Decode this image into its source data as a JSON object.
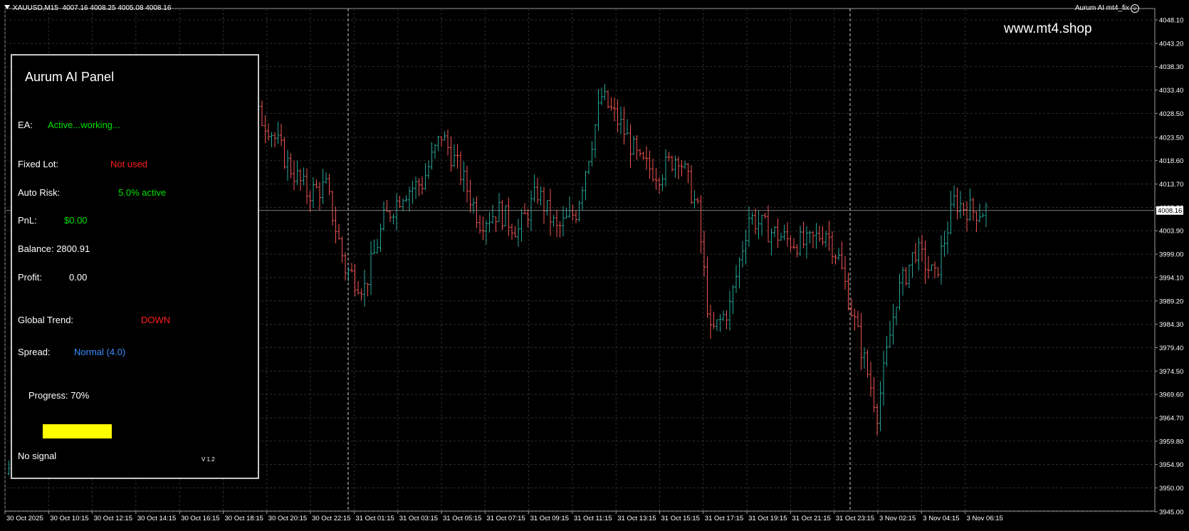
{
  "header": {
    "symbol": "XAUUSD,M15",
    "ohlc": "4007.16 4008.25 4005.08 4008.16",
    "ea_name": "Aurum AI mt4_fix"
  },
  "watermark": "www.mt4.shop",
  "panel": {
    "title": "Aurum AI Panel",
    "ea_label": "EA:",
    "ea_value": "Active...working...",
    "fixed_lot_label": "Fixed Lot:",
    "fixed_lot_value": "Not used",
    "auto_risk_label": "Auto Risk:",
    "auto_risk_value": "5.0% active",
    "pnl_label": "PnL:",
    "pnl_value": "$0.00",
    "balance_text": "Balance: 2800.91",
    "profit_label": "Profit:",
    "profit_value": "0.00",
    "global_trend_label": "Global Trend:",
    "global_trend_value": "DOWN",
    "spread_label": "Spread:",
    "spread_value": "Normal (4.0)",
    "progress_text": "Progress: 70%",
    "progress": 0.7,
    "signal_text": "No signal",
    "version": "V 1.2"
  },
  "colors": {
    "background": "#000000",
    "grid": "#2e2e2e",
    "bull": "#26a69a",
    "bear": "#ef5350",
    "green_text": "#00e000",
    "red_text": "#ff2020",
    "blue_text": "#3a8eff",
    "progress": "#ffff00",
    "panel_border": "#c8c8c8"
  },
  "chart_data": {
    "type": "candlestick",
    "symbol": "XAUUSD",
    "timeframe": "M15",
    "y_ticks": [
      "4048.10",
      "4043.20",
      "4038.30",
      "4033.40",
      "4028.50",
      "4023.50",
      "4018.60",
      "4013.70",
      "4008.80",
      "4003.90",
      "3999.00",
      "3994.10",
      "3989.20",
      "3984.30",
      "3979.40",
      "3974.50",
      "3969.60",
      "3964.70",
      "3959.80",
      "3954.90",
      "3950.00",
      "3945.00"
    ],
    "ylim": [
      3945.0,
      4048.1
    ],
    "x_ticks": [
      "30 Oct 2025",
      "30 Oct 10:15",
      "30 Oct 12:15",
      "30 Oct 14:15",
      "30 Oct 16:15",
      "30 Oct 18:15",
      "30 Oct 20:15",
      "30 Oct 22:15",
      "31 Oct 01:15",
      "31 Oct 03:15",
      "31 Oct 05:15",
      "31 Oct 07:15",
      "31 Oct 09:15",
      "31 Oct 11:15",
      "31 Oct 13:15",
      "31 Oct 15:15",
      "31 Oct 17:15",
      "31 Oct 19:15",
      "31 Oct 21:15",
      "31 Oct 23:15",
      "3 Nov 02:15",
      "3 Nov 04:15",
      "3 Nov 06:15"
    ],
    "current_price": "4008.16",
    "current_price_value": 4008.16,
    "close_path": [
      [
        0,
        3953
      ],
      [
        8,
        3962
      ],
      [
        22,
        4000
      ],
      [
        30,
        3998
      ],
      [
        36,
        4010
      ],
      [
        40,
        4020
      ],
      [
        45,
        4025
      ],
      [
        52,
        4022
      ],
      [
        58,
        4025
      ],
      [
        64,
        4038
      ],
      [
        70,
        4032
      ],
      [
        76,
        4030
      ],
      [
        82,
        4026
      ],
      [
        88,
        4018
      ],
      [
        94,
        4012
      ],
      [
        100,
        4013
      ],
      [
        106,
        3996
      ],
      [
        112,
        3992
      ],
      [
        118,
        4006
      ],
      [
        124,
        4012
      ],
      [
        130,
        4014
      ],
      [
        136,
        4024
      ],
      [
        142,
        4016
      ],
      [
        148,
        4006
      ],
      [
        154,
        4008
      ],
      [
        160,
        4004
      ],
      [
        166,
        4012
      ],
      [
        172,
        4004
      ],
      [
        178,
        4008
      ],
      [
        186,
        4032
      ],
      [
        192,
        4026
      ],
      [
        198,
        4018
      ],
      [
        204,
        4016
      ],
      [
        210,
        4020
      ],
      [
        216,
        4008
      ],
      [
        220,
        3982
      ],
      [
        226,
        3988
      ],
      [
        232,
        4007
      ],
      [
        238,
        4004
      ],
      [
        244,
        4002
      ],
      [
        250,
        4001
      ],
      [
        256,
        4004
      ],
      [
        260,
        3998
      ],
      [
        266,
        3982
      ],
      [
        272,
        3966
      ],
      [
        278,
        3990
      ],
      [
        284,
        4000
      ],
      [
        290,
        3994
      ],
      [
        296,
        4010
      ],
      [
        302,
        4008
      ],
      [
        306,
        4008.16
      ]
    ]
  }
}
